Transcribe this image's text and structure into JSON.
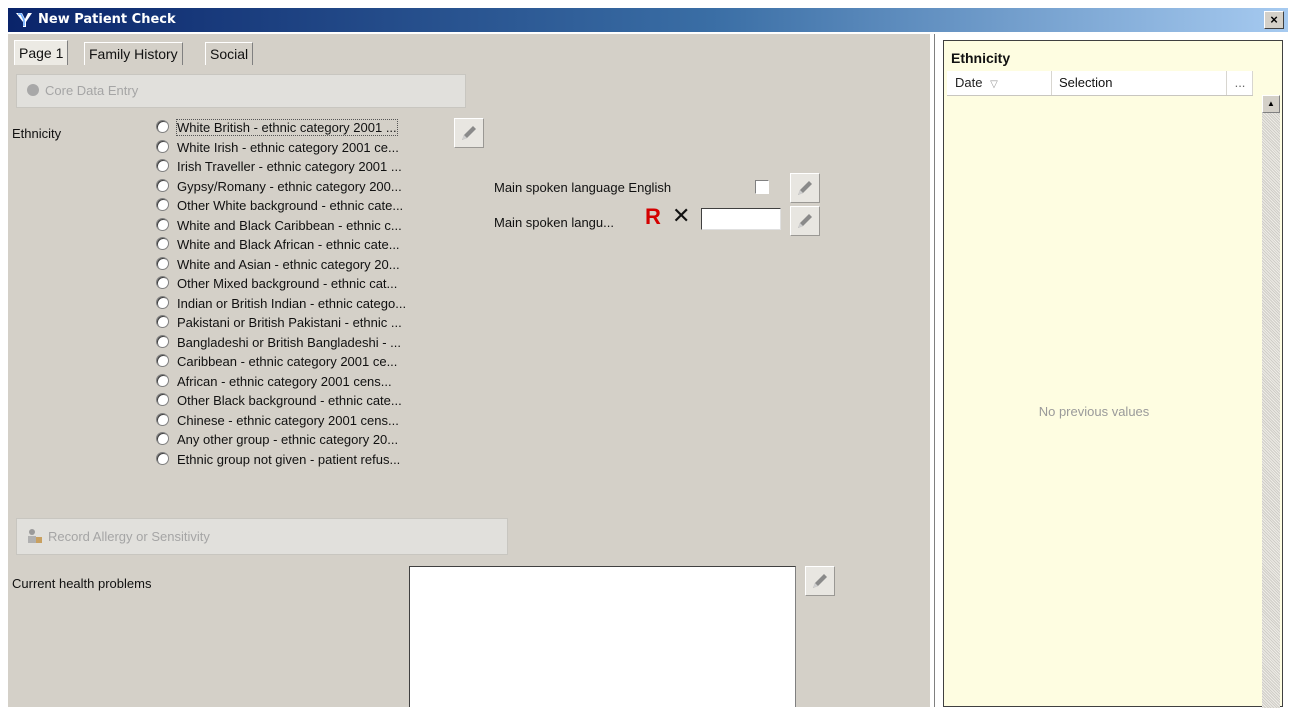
{
  "window": {
    "title": "New Patient Check",
    "close_label": "×"
  },
  "tabs": [
    {
      "label": "Page 1",
      "active": true
    },
    {
      "label": "Family History",
      "active": false
    },
    {
      "label": "Social",
      "active": false
    }
  ],
  "core_data_button": {
    "label": "Core Data Entry"
  },
  "ethnicity": {
    "label": "Ethnicity",
    "options": [
      "White British - ethnic category 2001 ...",
      "White Irish - ethnic category 2001 ce...",
      "Irish Traveller - ethnic category 2001 ...",
      "Gypsy/Romany - ethnic category 200...",
      "Other White background - ethnic cate...",
      "White and Black Caribbean - ethnic c...",
      "White and Black African - ethnic cate...",
      "White and Asian - ethnic category 20...",
      "Other Mixed background - ethnic cat...",
      "Indian or British Indian - ethnic catego...",
      "Pakistani or British Pakistani - ethnic ...",
      "Bangladeshi or British Bangladeshi - ...",
      "Caribbean - ethnic category 2001 ce...",
      "African - ethnic category 2001 cens...",
      "Other Black background - ethnic cate...",
      "Chinese - ethnic category 2001 cens...",
      "Any other group - ethnic category 20...",
      "Ethnic group not given - patient refus..."
    ]
  },
  "language": {
    "english_label": "Main spoken language English",
    "english_checked": false,
    "main_label": "Main spoken langu...",
    "r_label": "R",
    "x_label": "✕",
    "main_value": ""
  },
  "allergy_button": {
    "label": "Record Allergy or Sensitivity"
  },
  "health": {
    "label": "Current health problems",
    "value": ""
  },
  "history_panel": {
    "title": "Ethnicity",
    "columns": {
      "date": "Date",
      "selection": "Selection",
      "more": "..."
    },
    "empty_message": "No previous values"
  },
  "colors": {
    "panel_bg": "#d4d0c8",
    "history_bg": "#fefde1",
    "title_gradient_start": "#0a246a",
    "title_gradient_end": "#a6caf0",
    "r_icon": "#d40000"
  }
}
